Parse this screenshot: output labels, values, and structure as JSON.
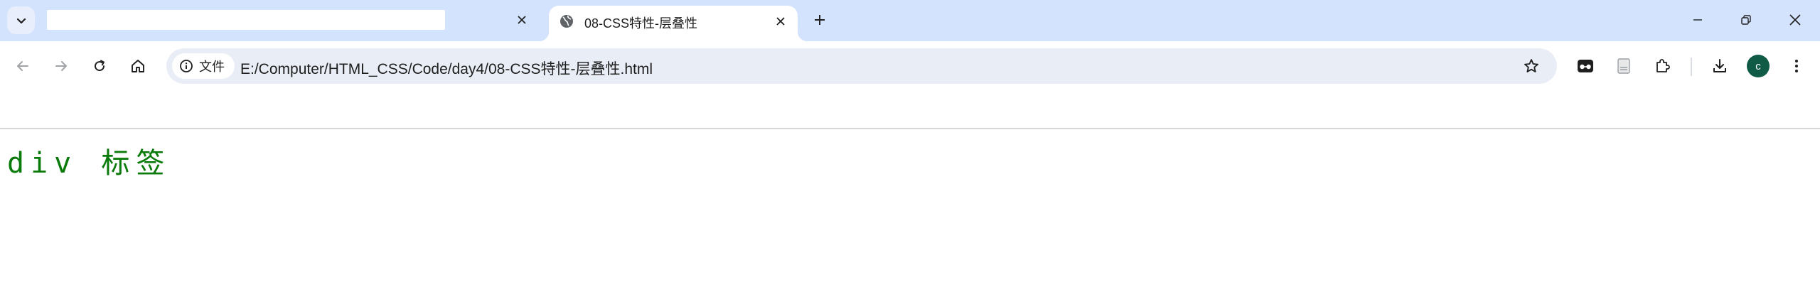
{
  "tabs": [
    {
      "title": ""
    },
    {
      "title": "08-CSS特性-层叠性"
    }
  ],
  "address_bar": {
    "site_chip_label": "文件",
    "url": "E:/Computer/HTML_CSS/Code/day4/08-CSS特性-层叠性.html"
  },
  "profile": {
    "initial": "c",
    "color": "#0f5b46"
  },
  "page": {
    "text": "div 标签",
    "text_color": "#0a7a0a"
  },
  "colors": {
    "tab_strip": "#d3e3fd",
    "omnibox": "#e9eef6"
  }
}
